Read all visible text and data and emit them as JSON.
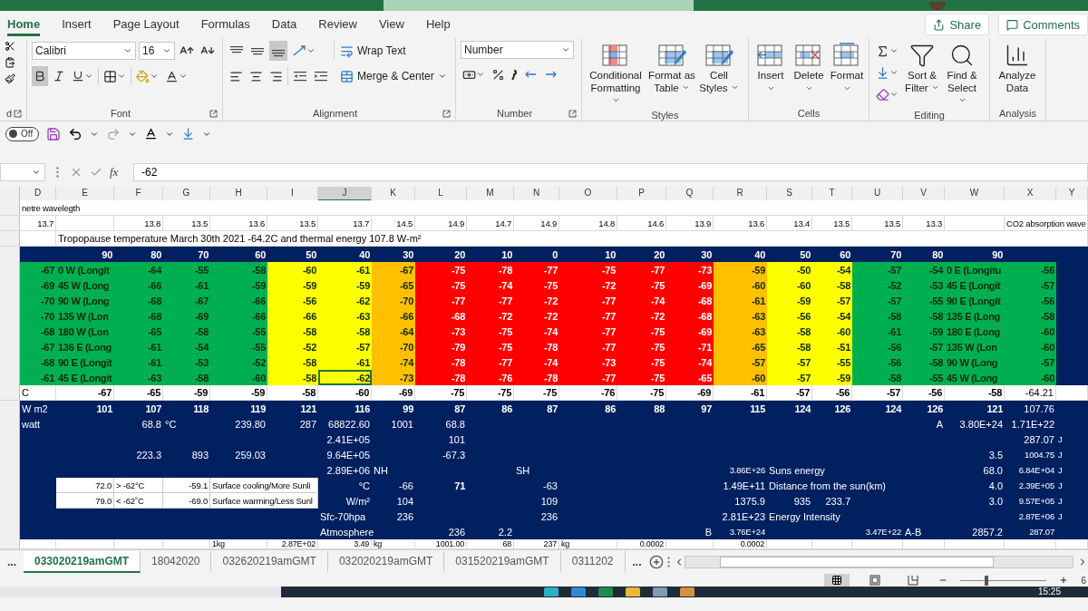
{
  "ribbon_tabs": [
    {
      "label": "Home",
      "selected": true
    },
    {
      "label": "Insert",
      "selected": false
    },
    {
      "label": "Page Layout",
      "selected": false
    },
    {
      "label": "Formulas",
      "selected": false
    },
    {
      "label": "Data",
      "selected": false
    },
    {
      "label": "Review",
      "selected": false
    },
    {
      "label": "View",
      "selected": false
    },
    {
      "label": "Help",
      "selected": false
    }
  ],
  "share": "Share",
  "comments": "Comments",
  "ribbon": {
    "clipboard_label": "d",
    "font_label": "Font",
    "font_name": "Calibri",
    "font_size": "16",
    "bold_on": true,
    "alignment_label": "Alignment",
    "bottom_align_on": true,
    "wrap_text": "Wrap Text",
    "merge": "Merge & Center",
    "number_label": "Number",
    "number_format": "Number",
    "styles_label": "Styles",
    "styles": [
      "Conditional Formatting",
      "Format as Table",
      "Cell Styles"
    ],
    "cells_label": "Cells",
    "cells": [
      "Insert",
      "Delete",
      "Format"
    ],
    "editing_label": "Editing",
    "editing": [
      "Sort & Filter",
      "Find & Select"
    ],
    "analysis_label": "Analysis",
    "analysis": [
      "Analyze Data"
    ]
  },
  "qat": {
    "autosave": {
      "label": "Off",
      "on": false
    }
  },
  "formula_bar": {
    "fx": "fx",
    "value": "-62"
  },
  "sheet": {
    "columns": [
      {
        "label": "D",
        "selected": false,
        "color": "#00b050"
      },
      {
        "label": "E",
        "selected": false,
        "color": "#00b050"
      },
      {
        "label": "F",
        "selected": false,
        "color": "#00b050"
      },
      {
        "label": "G",
        "selected": false,
        "color": "#00b050"
      },
      {
        "label": "H",
        "selected": false,
        "color": "#00b050"
      },
      {
        "label": "I",
        "selected": false,
        "color": "#ffff00"
      },
      {
        "label": "J",
        "selected": true,
        "color": "#ffff00"
      },
      {
        "label": "K",
        "selected": false,
        "color": "#ffc000"
      },
      {
        "label": "L",
        "selected": false,
        "color": "#ff0000"
      },
      {
        "label": "M",
        "selected": false,
        "color": "#ff0000"
      },
      {
        "label": "N",
        "selected": false,
        "color": "#ff0000"
      },
      {
        "label": "O",
        "selected": false,
        "color": "#ff0000"
      },
      {
        "label": "P",
        "selected": false,
        "color": "#ff0000"
      },
      {
        "label": "Q",
        "selected": false,
        "color": "#ff0000"
      },
      {
        "label": "R",
        "selected": false,
        "color": "#ffc000"
      },
      {
        "label": "S",
        "selected": false,
        "color": "#ffff00"
      },
      {
        "label": "T",
        "selected": false,
        "color": "#ffff00"
      },
      {
        "label": "U",
        "selected": false,
        "color": "#00b050"
      },
      {
        "label": "V",
        "selected": false,
        "color": "#00b050"
      },
      {
        "label": "W",
        "selected": false,
        "color": "#00b050"
      },
      {
        "label": "X",
        "selected": false,
        "color": "#00b050"
      },
      {
        "label": "Y",
        "selected": false
      }
    ],
    "rows": [
      {
        "kind": "plain",
        "small": true,
        "cells": [
          {
            "text": "netre wavelegth",
            "kind": "label"
          }
        ]
      },
      {
        "kind": "plain",
        "small": true,
        "cells": [
          "13.7",
          null,
          "13.8",
          "13.5",
          "13.6",
          "13.5",
          "13.7",
          "14.5",
          "14.9",
          "14.7",
          "14.9",
          "14.8",
          "14.6",
          "13.9",
          "13.6",
          "13.4",
          "13.5",
          "13.5",
          "13.3",
          null,
          {
            "text": "CO2 absorption wave",
            "kind": "label"
          }
        ]
      },
      {
        "kind": "plain",
        "cells": [
          null,
          {
            "text": "Tropopause temperature March 30th 2021  -64.2C and thermal energy 107.8 W-m²",
            "kind": "label"
          }
        ]
      },
      {
        "kind": "navy",
        "bold": true,
        "cells": [
          null,
          "90",
          "80",
          "70",
          "60",
          "50",
          "40",
          "30",
          "20",
          "10",
          "0",
          "10",
          "20",
          "30",
          "40",
          "50",
          "60",
          "70",
          "80",
          "90"
        ]
      },
      {
        "kind": "band",
        "bold": true,
        "cells": [
          "-67",
          {
            "text": "0 W (Longit",
            "kind": "label"
          },
          "-64",
          "-55",
          "-58",
          "-60",
          "-61",
          "-67",
          "-75",
          "-78",
          "-77",
          "-75",
          "-77",
          "-73",
          "-59",
          "-50",
          "-54",
          "-57",
          "-54",
          {
            "text": "0 E (Longitu",
            "kind": "label"
          },
          "-56"
        ]
      },
      {
        "kind": "band",
        "bold": true,
        "cells": [
          "-69",
          {
            "text": "45 W (Long",
            "kind": "label"
          },
          "-66",
          "-61",
          "-59",
          "-59",
          "-59",
          "-65",
          "-75",
          "-74",
          "-75",
          "-72",
          "-75",
          "-69",
          "-60",
          "-60",
          "-58",
          "-52",
          "-53",
          {
            "text": "45 E (Longit",
            "kind": "label"
          },
          "-57"
        ]
      },
      {
        "kind": "band",
        "bold": true,
        "cells": [
          "-70",
          {
            "text": "90 W (Long",
            "kind": "label"
          },
          "-68",
          "-67",
          "-66",
          "-56",
          "-62",
          "-70",
          "-77",
          "-77",
          "-72",
          "-77",
          "-74",
          "-68",
          "-61",
          "-59",
          "-57",
          "-57",
          "-55",
          {
            "text": "90 E (Longit",
            "kind": "label"
          },
          "-56"
        ]
      },
      {
        "kind": "band",
        "bold": true,
        "cells": [
          "-70",
          {
            "text": "135 W (Lon",
            "kind": "label"
          },
          "-68",
          "-69",
          "-66",
          "-66",
          "-63",
          "-66",
          "-68",
          "-72",
          "-72",
          "-77",
          "-72",
          "-68",
          "-63",
          "-56",
          "-54",
          "-58",
          "-58",
          {
            "text": "135 E (Long",
            "kind": "label"
          },
          "-58"
        ]
      },
      {
        "kind": "band",
        "bold": true,
        "cells": [
          "-68",
          {
            "text": "180 W (Lon",
            "kind": "label"
          },
          "-65",
          "-58",
          "-55",
          "-58",
          "-58",
          "-64",
          "-73",
          "-75",
          "-74",
          "-77",
          "-75",
          "-69",
          "-63",
          "-58",
          "-60",
          "-61",
          "-59",
          {
            "text": "180 E (Long",
            "kind": "label"
          },
          "-60"
        ]
      },
      {
        "kind": "band",
        "bold": true,
        "cells": [
          "-67",
          {
            "text": "136 E (Long",
            "kind": "label"
          },
          "-61",
          "-54",
          "-55",
          "-52",
          "-57",
          "-70",
          "-79",
          "-75",
          "-78",
          "-77",
          "-75",
          "-71",
          "-65",
          "-58",
          "-51",
          "-56",
          "-57",
          {
            "text": "135 W (Lon",
            "kind": "label"
          },
          "-60"
        ]
      },
      {
        "kind": "band",
        "bold": true,
        "cells": [
          "-68",
          {
            "text": "90 E (Longit",
            "kind": "label"
          },
          "-61",
          "-53",
          "-52",
          "-58",
          "-61",
          "-74",
          "-78",
          "-77",
          "-74",
          "-73",
          "-75",
          "-74",
          "-57",
          "-57",
          "-55",
          "-56",
          "-58",
          {
            "text": "90 W (Long",
            "kind": "label"
          },
          "-57"
        ]
      },
      {
        "kind": "band",
        "bold": true,
        "cells": [
          "-61",
          {
            "text": "45 E (Longit",
            "kind": "label"
          },
          "-63",
          "-58",
          "-60",
          "-58",
          {
            "text": "-62",
            "selected": true
          },
          "-73",
          "-78",
          "-76",
          "-78",
          "-77",
          "-75",
          "-65",
          "-60",
          "-57",
          "-59",
          "-58",
          "-55",
          {
            "text": "45 W (Long",
            "kind": "label"
          },
          "-60"
        ]
      },
      {
        "kind": "plain",
        "bold": true,
        "cells": [
          {
            "text": "C",
            "kind": "label",
            "bold": false
          },
          "-67",
          "-65",
          "-59",
          "-59",
          "-58",
          "-60",
          "-69",
          "-75",
          "-75",
          "-75",
          "-76",
          "-75",
          "-69",
          "-61",
          "-57",
          "-56",
          "-57",
          "-56",
          "-58",
          {
            "text": "-64.21",
            "bold": false
          }
        ]
      },
      {
        "kind": "navy",
        "bold": true,
        "cells": [
          {
            "text": "W m2",
            "kind": "label",
            "bold": false
          },
          "101",
          "107",
          "118",
          "119",
          "121",
          "116",
          "99",
          "87",
          "86",
          "87",
          "86",
          "88",
          "97",
          "115",
          "124",
          "126",
          "124",
          "126",
          "121",
          {
            "text": "107.76",
            "bold": false
          }
        ]
      },
      {
        "kind": "navy",
        "cells": [
          {
            "text": "watt",
            "kind": "label"
          },
          null,
          "68.8",
          {
            "text": "°C",
            "kind": "label"
          },
          "239.80",
          "287",
          "68822.60",
          "1001",
          "68.8",
          null,
          null,
          null,
          null,
          null,
          null,
          null,
          null,
          null,
          "A",
          "3.80E+24",
          "1.71E+22"
        ]
      },
      {
        "kind": "navy",
        "cells": [
          null,
          null,
          null,
          null,
          null,
          null,
          "2.41E+05",
          null,
          "101",
          null,
          null,
          null,
          null,
          null,
          null,
          null,
          null,
          null,
          null,
          null,
          "287.07",
          {
            "text": "J",
            "kind": "label",
            "small": true
          }
        ]
      },
      {
        "kind": "navy",
        "cells": [
          null,
          null,
          "223.3",
          "893",
          "259.03",
          null,
          "9.64E+05",
          null,
          "-67.3",
          null,
          null,
          null,
          null,
          null,
          null,
          null,
          null,
          null,
          null,
          "3.5",
          {
            "text": "1004.75",
            "small": true
          },
          {
            "text": "J",
            "kind": "label",
            "small": true
          }
        ]
      },
      {
        "kind": "navy",
        "cells": [
          null,
          null,
          null,
          null,
          null,
          null,
          "2.89E+06",
          {
            "text": "NH",
            "kind": "label"
          },
          null,
          null,
          {
            "text": "SH",
            "kind": "label"
          },
          null,
          null,
          null,
          {
            "text": "3.86E+26",
            "small": true
          },
          {
            "text": "Suns energy",
            "kind": "label"
          },
          null,
          null,
          null,
          "68.0",
          {
            "text": "6.84E+04",
            "small": true
          },
          {
            "text": "J",
            "kind": "label",
            "small": true
          }
        ]
      },
      {
        "kind": "navy",
        "cells": [
          null,
          {
            "text": "72.0",
            "kind": "boxed"
          },
          {
            "text": "> -62°C",
            "kind": "boxed-label"
          },
          {
            "text": "-59.1",
            "kind": "boxed"
          },
          {
            "text": "Surface cooling/More Sunli",
            "kind": "boxed-label"
          },
          null,
          "°C",
          "-66",
          {
            "text": "71",
            "bold": true
          },
          null,
          "-63",
          null,
          null,
          null,
          "1.49E+11",
          {
            "text": "Distance from the sun(km)",
            "kind": "label"
          },
          null,
          null,
          null,
          "4.0",
          {
            "text": "2.39E+05",
            "small": true
          },
          {
            "text": "J",
            "kind": "label",
            "small": true
          }
        ]
      },
      {
        "kind": "navy",
        "cells": [
          null,
          {
            "text": "79.0",
            "kind": "boxed"
          },
          {
            "text": "< -62˚C",
            "kind": "boxed-label"
          },
          {
            "text": "-69.0",
            "kind": "boxed"
          },
          {
            "text": "Surface warming/Less Sunl",
            "kind": "boxed-label"
          },
          null,
          "W/m²",
          "104",
          null,
          null,
          "109",
          null,
          null,
          null,
          "1375.9",
          "935",
          "233.7",
          null,
          null,
          "3.0",
          {
            "text": "9.57E+05",
            "small": true
          },
          {
            "text": "J",
            "kind": "label",
            "small": true
          }
        ]
      },
      {
        "kind": "navy",
        "cells": [
          null,
          null,
          null,
          null,
          null,
          null,
          {
            "text": "Sfc-70hpa",
            "kind": "label"
          },
          "236",
          null,
          null,
          "236",
          null,
          null,
          null,
          "2.81E+23",
          {
            "text": "Energy Intensity",
            "kind": "label"
          },
          null,
          null,
          null,
          null,
          {
            "text": "2.87E+06",
            "small": true
          },
          {
            "text": "J",
            "kind": "label",
            "small": true
          }
        ]
      },
      {
        "kind": "navy",
        "cells": [
          null,
          null,
          null,
          null,
          null,
          null,
          {
            "text": "Atmosphere",
            "kind": "label"
          },
          null,
          "236",
          "2.2",
          null,
          null,
          null,
          "B",
          {
            "text": "3.76E+24",
            "small": true
          },
          null,
          null,
          {
            "text": "3.47E+22",
            "small": true
          },
          {
            "text": "A-B",
            "kind": "label"
          },
          "2857.2",
          {
            "text": "287.07",
            "small": true
          }
        ]
      },
      {
        "kind": "cut",
        "cells": [
          null,
          null,
          null,
          null,
          {
            "text": "1kg",
            "kind": "label"
          },
          "2.87E+02",
          "3.49",
          {
            "text": "kg",
            "kind": "label"
          },
          "1001.00",
          "68",
          "237",
          {
            "text": "kg",
            "kind": "label"
          },
          "0.0002",
          null,
          "0.0002"
        ]
      }
    ]
  },
  "sheet_tabs": {
    "overflow_left": "...",
    "tabs": [
      {
        "label": "033020219amGMT",
        "selected": true
      },
      {
        "label": "18042020",
        "selected": false
      },
      {
        "label": "032620219amGMT",
        "selected": false
      },
      {
        "label": "032020219amGMT",
        "selected": false
      },
      {
        "label": "031520219amGMT",
        "selected": false
      },
      {
        "label": "0311202",
        "selected": false
      }
    ],
    "overflow_right": "..."
  },
  "status_bar": {
    "zoom": {
      "level": 0.28,
      "reading": "6"
    }
  },
  "taskbar": {
    "clock": "15:25"
  }
}
